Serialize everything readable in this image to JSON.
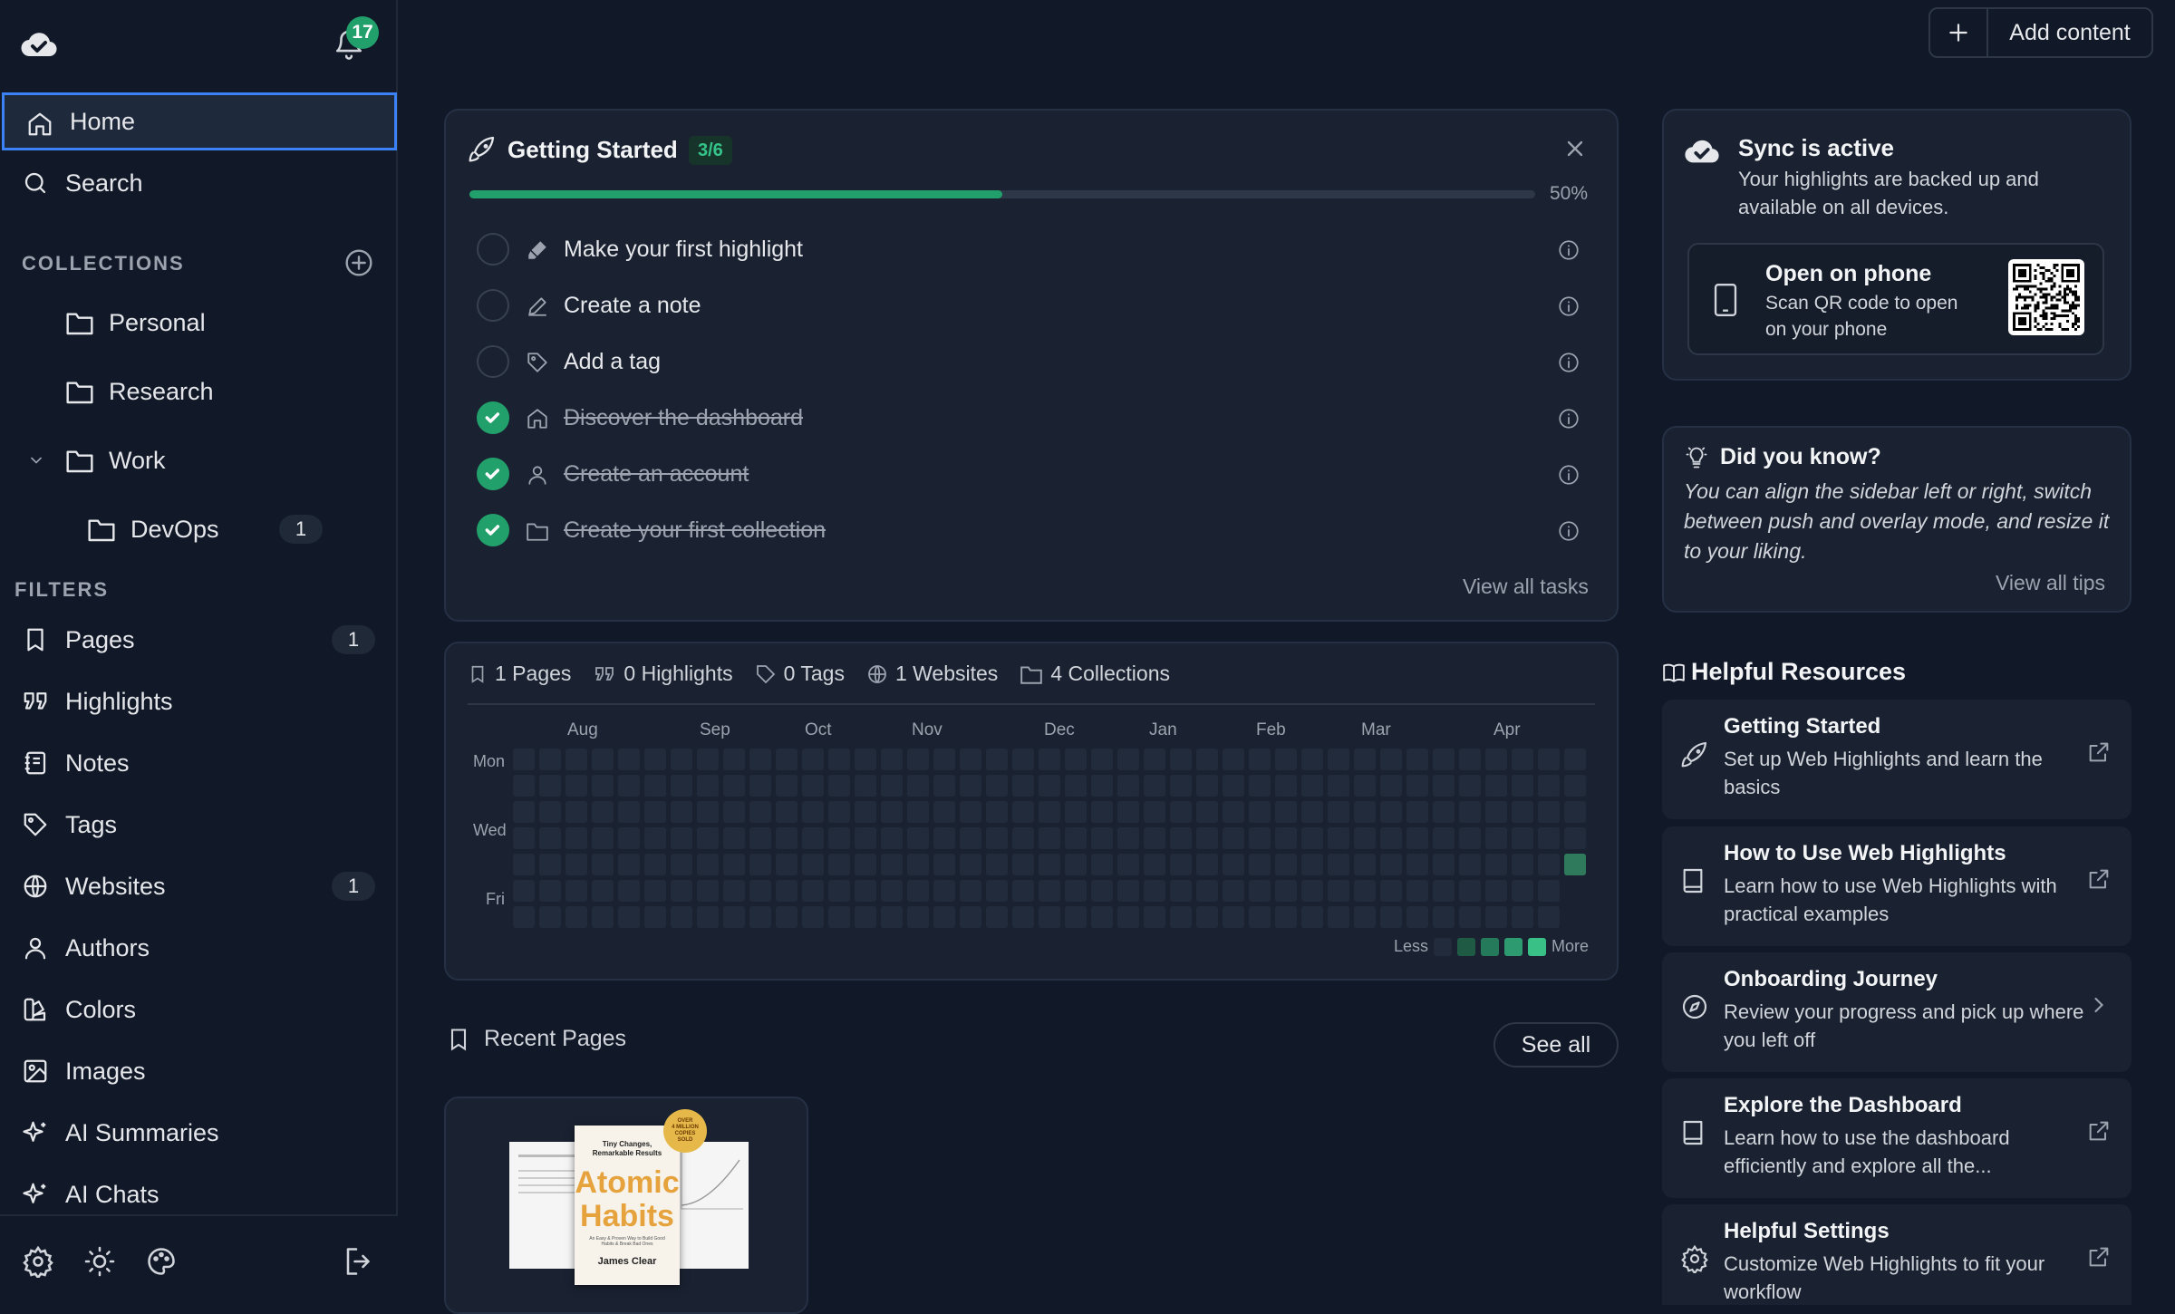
{
  "notifications": {
    "count": "17"
  },
  "nav": {
    "home": "Home",
    "search": "Search",
    "pages": {
      "label": "Pages",
      "count": "1"
    },
    "highlights": "Highlights",
    "notes": "Notes",
    "tags": "Tags",
    "websites": {
      "label": "Websites",
      "count": "1"
    },
    "authors": "Authors",
    "colors": "Colors",
    "images": "Images",
    "ai_summaries": "AI Summaries",
    "ai_chats": "AI Chats"
  },
  "collections": {
    "heading": "COLLECTIONS",
    "items": [
      {
        "label": "Personal"
      },
      {
        "label": "Research"
      },
      {
        "label": "Work"
      },
      {
        "label": "DevOps",
        "count": "1"
      }
    ]
  },
  "filters": {
    "heading": "FILTERS"
  },
  "topbar": {
    "add_content": "Add content"
  },
  "getting_started": {
    "title": "Getting Started",
    "progress_badge": "3/6",
    "progress": 0.5,
    "progress_label": "50%",
    "tasks": [
      {
        "label": "Make your first highlight",
        "done": false,
        "icon": "highlighter-icon"
      },
      {
        "label": "Create a note",
        "done": false,
        "icon": "pencil-icon"
      },
      {
        "label": "Add a tag",
        "done": false,
        "icon": "tag-icon"
      },
      {
        "label": "Discover the dashboard",
        "done": true,
        "icon": "home-icon"
      },
      {
        "label": "Create an account",
        "done": true,
        "icon": "user-icon"
      },
      {
        "label": "Create your first collection",
        "done": true,
        "icon": "folder-icon"
      }
    ],
    "view_all": "View all tasks"
  },
  "stats": {
    "pages": "1 Pages",
    "highlights": "0 Highlights",
    "tags": "0 Tags",
    "websites": "1 Websites",
    "collections": "4 Collections"
  },
  "heatmap": {
    "months": [
      "Aug",
      "Sep",
      "Oct",
      "Nov",
      "Dec",
      "Jan",
      "Feb",
      "Mar",
      "Apr"
    ],
    "days": [
      "Mon",
      "Wed",
      "Fri"
    ],
    "less": "Less",
    "more": "More"
  },
  "recent_pages": {
    "title": "Recent Pages",
    "see_all": "See all"
  },
  "book": {
    "tagline": "Tiny Changes, Remarkable Results",
    "title_line1": "Atomic",
    "title_line2": "Habits",
    "subtitle": "An Easy & Proven Way to Build Good Habits & Break Bad Ones",
    "author": "James Clear",
    "seal_line1": "OVER",
    "seal_line2": "4 MILLION",
    "seal_line3": "COPIES",
    "seal_line4": "SOLD"
  },
  "sync": {
    "title": "Sync is active",
    "subtitle": "Your highlights are backed up and available on all devices.",
    "phone_title": "Open on phone",
    "phone_subtitle": "Scan QR code to open on your phone"
  },
  "did_you_know": {
    "title": "Did you know?",
    "text": "You can align the sidebar left or right, switch between push and overlay mode, and resize it to your liking.",
    "view_all": "View all tips"
  },
  "helpful_resources": {
    "title": "Helpful Resources",
    "items": [
      {
        "title": "Getting Started",
        "subtitle": "Set up Web Highlights and learn the basics",
        "icon": "rocket-icon",
        "action": "external-link-icon"
      },
      {
        "title": "How to Use Web Highlights",
        "subtitle": "Learn how to use Web Highlights with practical examples",
        "icon": "book-icon",
        "action": "external-link-icon"
      },
      {
        "title": "Onboarding Journey",
        "subtitle": "Review your progress and pick up where you left off",
        "icon": "compass-icon",
        "action": "chevron-right-icon"
      },
      {
        "title": "Explore the Dashboard",
        "subtitle": "Learn how to use the dashboard efficiently and explore all the...",
        "icon": "book-icon",
        "action": "external-link-icon"
      },
      {
        "title": "Helpful Settings",
        "subtitle": "Customize Web Highlights to fit your workflow",
        "icon": "gear-icon",
        "action": "external-link-icon"
      }
    ]
  },
  "colors": {
    "accent": "#22a06b",
    "active_border": "#3b82f6",
    "background": "#111827",
    "card": "#1a2231"
  }
}
